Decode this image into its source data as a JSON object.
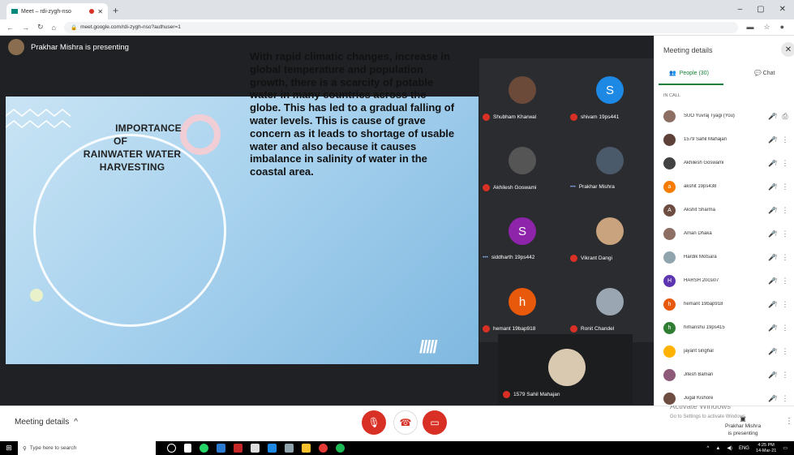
{
  "browser": {
    "tab_title": "Meet – rdi-zygh-nso",
    "url": "meet.google.com/rdi-zygh-nso?authuser=1"
  },
  "stage": {
    "presenting_label": "Prakhar Mishra is presenting"
  },
  "slide": {
    "title_lines": [
      "IMPORTANCE",
      "OF",
      "RAINWATER WATER",
      "HARVESTING"
    ],
    "body": "With rapid climatic changes, increase in global temperature and population growth, there is a scarcity of potable water in many countries across the globe. This has led to a gradual falling of water levels. This is cause of grave concern as it leads to shortage of usable water and also because it causes imbalance in salinity of water in the coastal area."
  },
  "tiles": [
    {
      "name": "Shubham Kharwal",
      "initial": "",
      "color": "#6b4a3a",
      "muted": true
    },
    {
      "name": "shivam 19ps441",
      "initial": "S",
      "color": "#1e88e5",
      "muted": true
    },
    {
      "name": "Akhilesh Goswami",
      "initial": "",
      "color": "#555555",
      "muted": true
    },
    {
      "name": "Prakhar Mishra",
      "initial": "",
      "color": "#4a5a6a",
      "muted": false
    },
    {
      "name": "siddharth 19ps442",
      "initial": "S",
      "color": "#8e24aa",
      "muted": false
    },
    {
      "name": "Vikrant Dangi",
      "initial": "",
      "color": "#c9a27e",
      "muted": true
    },
    {
      "name": "hemant 19bap918",
      "initial": "h",
      "color": "#e8590c",
      "muted": true
    },
    {
      "name": "Ronit Chandel",
      "initial": "",
      "color": "#9aa6b2",
      "muted": true
    }
  ],
  "big_tile": {
    "name": "1579 Sahil Mahajan"
  },
  "bottom": {
    "meeting_details": "Meeting details",
    "activate_title": "Activate Windows",
    "activate_sub": "Go to Settings to activate Windows.",
    "presenting_note_1": "Prakhar Mishra",
    "presenting_note_2": "is presenting"
  },
  "panel": {
    "title": "Meeting details",
    "people_tab": "People (30)",
    "chat_tab": "Chat",
    "section": "IN CALL",
    "people": [
      {
        "name": "SUO Yuvraj Tyagi (You)",
        "initial": "",
        "color": "#8d6e63"
      },
      {
        "name": "1579 Sahil Mahajan",
        "initial": "",
        "color": "#5d4037"
      },
      {
        "name": "Akhilesh Goswami",
        "initial": "",
        "color": "#424242"
      },
      {
        "name": "akshit 19ps438",
        "initial": "a",
        "color": "#f57c00"
      },
      {
        "name": "Akshit Sharma",
        "initial": "A",
        "color": "#6d4c41"
      },
      {
        "name": "Aman Dhaka",
        "initial": "",
        "color": "#8d6e63"
      },
      {
        "name": "Hardik Motsara",
        "initial": "",
        "color": "#90a4ae"
      },
      {
        "name": "HARSH 20csi07",
        "initial": "H",
        "color": "#5e35b1"
      },
      {
        "name": "hemant 19bap918",
        "initial": "h",
        "color": "#e8590c"
      },
      {
        "name": "himanshu 19ps415",
        "initial": "h",
        "color": "#2e7d32"
      },
      {
        "name": "jayant singhal",
        "initial": "",
        "color": "#ffb300"
      },
      {
        "name": "Jitesh Baman",
        "initial": "",
        "color": "#8e5a7a"
      },
      {
        "name": "Jugal Kishore",
        "initial": "",
        "color": "#6d4c41"
      }
    ]
  },
  "taskbar": {
    "search_placeholder": "Type here to search",
    "lang": "ENG",
    "time": "4:25 PM",
    "date": "14-Mar-21"
  }
}
